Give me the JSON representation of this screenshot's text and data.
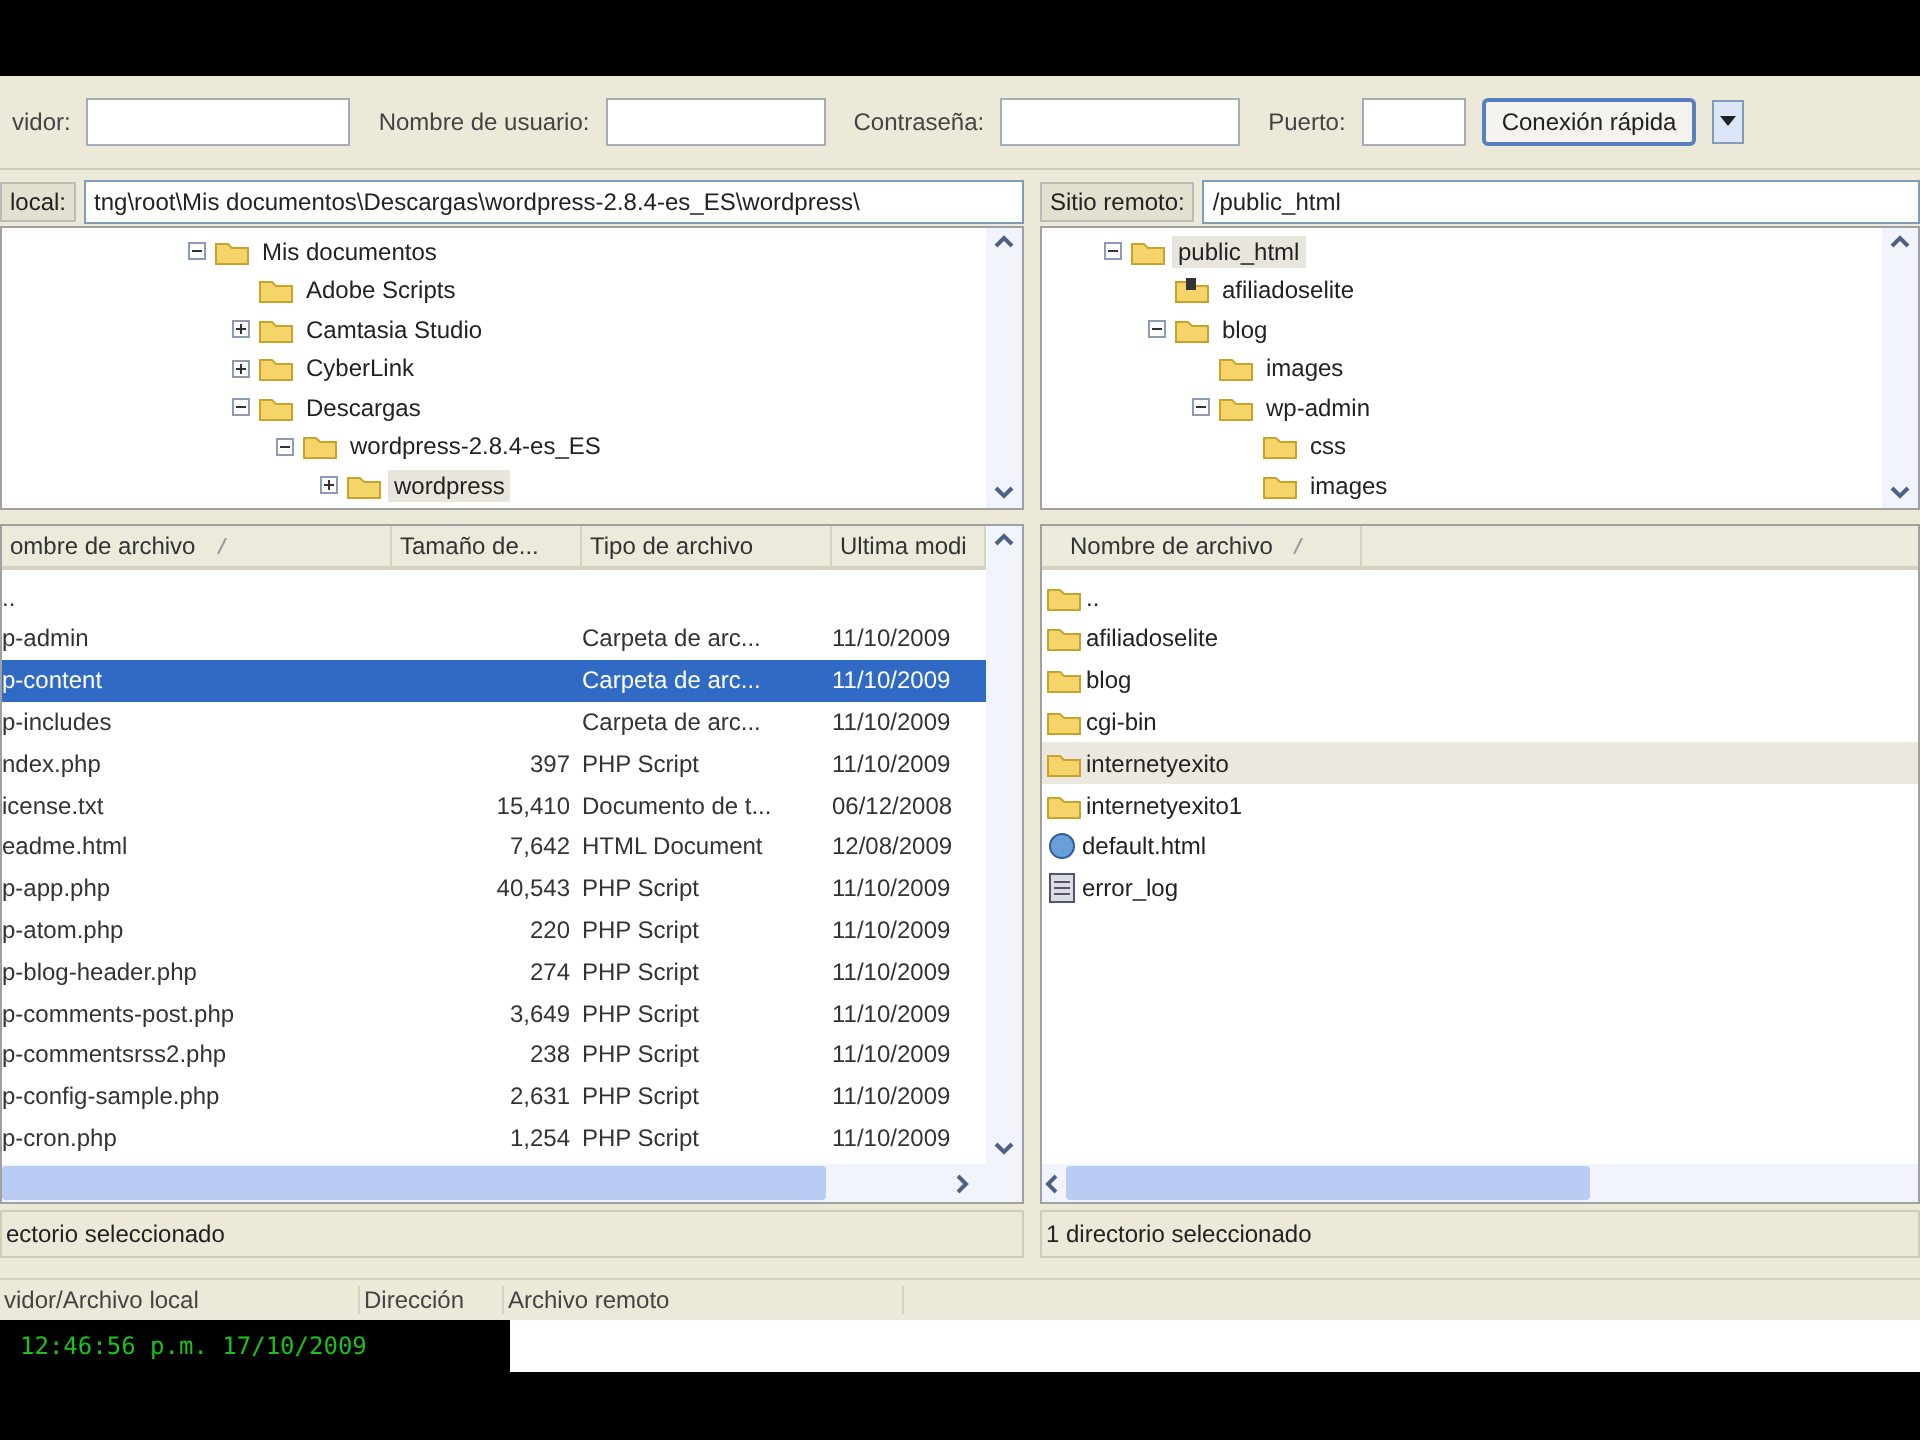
{
  "quickconnect": {
    "fields": [
      {
        "label": "vidor:"
      },
      {
        "label": "Nombre de usuario:"
      },
      {
        "label": "Contraseña:"
      },
      {
        "label": "Puerto:"
      }
    ],
    "button": "Conexión rápida"
  },
  "local": {
    "path_label": "local:",
    "path": "tng\\root\\Mis documentos\\Descargas\\wordpress-2.8.4-es_ES\\wordpress\\",
    "tree": [
      {
        "label": "Mis documentos",
        "kind": "folder",
        "expanded": true,
        "selected": false,
        "children": [
          {
            "label": "Adobe Scripts",
            "kind": "folder",
            "selected": false
          },
          {
            "label": "Camtasia Studio",
            "kind": "folder",
            "expanded": false,
            "selected": false
          },
          {
            "label": "CyberLink",
            "kind": "folder",
            "expanded": false,
            "selected": false
          },
          {
            "label": "Descargas",
            "kind": "folder",
            "expanded": true,
            "selected": false,
            "children": [
              {
                "label": "wordpress-2.8.4-es_ES",
                "kind": "folder",
                "expanded": true,
                "selected": false,
                "children": [
                  {
                    "label": "wordpress",
                    "kind": "folder",
                    "expanded": false,
                    "selected": true
                  }
                ]
              }
            ]
          }
        ]
      }
    ],
    "columns": [
      "ombre de archivo",
      "Tamaño de...",
      "Tipo de archivo",
      "Ultima modi"
    ],
    "rows": [
      {
        "name": "..",
        "size": "",
        "type": "",
        "date": "",
        "selected": false
      },
      {
        "name": "p-admin",
        "size": "",
        "type": "Carpeta de arc...",
        "date": "11/10/2009",
        "selected": false
      },
      {
        "name": "p-content",
        "size": "",
        "type": "Carpeta de arc...",
        "date": "11/10/2009",
        "selected": true
      },
      {
        "name": "p-includes",
        "size": "",
        "type": "Carpeta de arc...",
        "date": "11/10/2009",
        "selected": false
      },
      {
        "name": "ndex.php",
        "size": "397",
        "type": "PHP Script",
        "date": "11/10/2009",
        "selected": false
      },
      {
        "name": "icense.txt",
        "size": "15,410",
        "type": "Documento de t...",
        "date": "06/12/2008",
        "selected": false
      },
      {
        "name": "eadme.html",
        "size": "7,642",
        "type": "HTML Document",
        "date": "12/08/2009",
        "selected": false
      },
      {
        "name": "p-app.php",
        "size": "40,543",
        "type": "PHP Script",
        "date": "11/10/2009",
        "selected": false
      },
      {
        "name": "p-atom.php",
        "size": "220",
        "type": "PHP Script",
        "date": "11/10/2009",
        "selected": false
      },
      {
        "name": "p-blog-header.php",
        "size": "274",
        "type": "PHP Script",
        "date": "11/10/2009",
        "selected": false
      },
      {
        "name": "p-comments-post.php",
        "size": "3,649",
        "type": "PHP Script",
        "date": "11/10/2009",
        "selected": false
      },
      {
        "name": "p-commentsrss2.php",
        "size": "238",
        "type": "PHP Script",
        "date": "11/10/2009",
        "selected": false
      },
      {
        "name": "p-config-sample.php",
        "size": "2,631",
        "type": "PHP Script",
        "date": "11/10/2009",
        "selected": false
      },
      {
        "name": "p-cron.php",
        "size": "1,254",
        "type": "PHP Script",
        "date": "11/10/2009",
        "selected": false
      }
    ],
    "status": "ectorio seleccionado"
  },
  "remote": {
    "path_label": "Sitio remoto:",
    "path": "/public_html",
    "tree": [
      {
        "label": "public_html",
        "kind": "folder",
        "expanded": true,
        "selected": true,
        "children": [
          {
            "label": "afiliadoselite",
            "kind": "special",
            "selected": false
          },
          {
            "label": "blog",
            "kind": "folder",
            "expanded": true,
            "selected": false,
            "children": [
              {
                "label": "images",
                "kind": "folder",
                "selected": false
              },
              {
                "label": "wp-admin",
                "kind": "folder",
                "expanded": true,
                "selected": false,
                "children": [
                  {
                    "label": "css",
                    "kind": "folder",
                    "selected": false
                  },
                  {
                    "label": "images",
                    "kind": "folder",
                    "selected": false
                  }
                ]
              }
            ]
          }
        ]
      }
    ],
    "columns": [
      "Nombre de archivo"
    ],
    "rows": [
      {
        "name": "..",
        "kind": "folder",
        "selected": false
      },
      {
        "name": "afiliadoselite",
        "kind": "folder",
        "selected": false
      },
      {
        "name": "blog",
        "kind": "folder",
        "selected": false
      },
      {
        "name": "cgi-bin",
        "kind": "folder",
        "selected": false
      },
      {
        "name": "internetyexito",
        "kind": "folder",
        "selected": true
      },
      {
        "name": "internetyexito1",
        "kind": "folder",
        "selected": false
      },
      {
        "name": "default.html",
        "kind": "html",
        "selected": false
      },
      {
        "name": "error_log",
        "kind": "file",
        "selected": false
      }
    ],
    "status": "1 directorio seleccionado"
  },
  "queue": {
    "columns": [
      "vidor/Archivo local",
      "Dirección",
      "Archivo remoto"
    ]
  },
  "clock": "12:46:56 p.m. 17/10/2009"
}
